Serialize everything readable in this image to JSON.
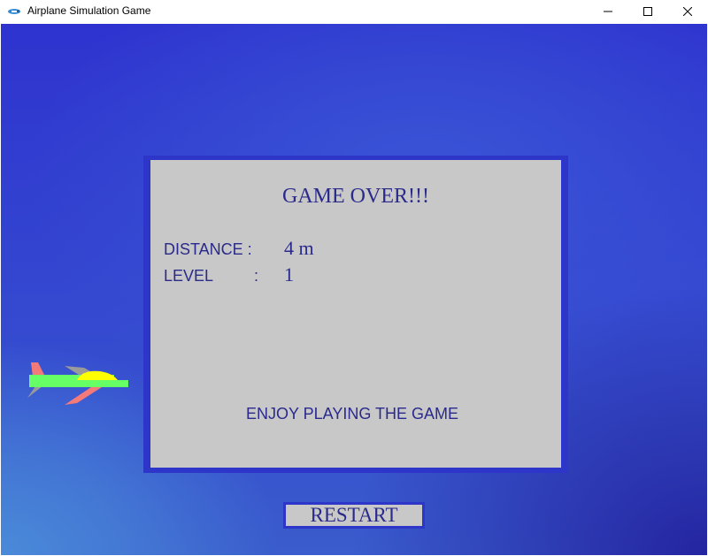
{
  "window": {
    "title": "Airplane Simulation Game",
    "icon": "airplane-app-icon",
    "controls": [
      "minimize-icon",
      "maximize-icon",
      "close-icon"
    ]
  },
  "dialog": {
    "heading": "GAME OVER!!!",
    "distance_label": "DISTANCE :",
    "distance_value": "4 m",
    "level_label": "LEVEL",
    "level_colon": ":",
    "level_value": "1",
    "footer": "ENJOY PLAYING THE GAME"
  },
  "restart_label": "RESTART",
  "colors": {
    "text": "#2a2a8c",
    "panel": "#c8c8c8",
    "frame": "#2d36c9",
    "plane_body": "#66ff66",
    "plane_cockpit": "#ffff00",
    "plane_wing_red": "#f47a7a",
    "plane_wing_grey": "#9a9a9a"
  }
}
